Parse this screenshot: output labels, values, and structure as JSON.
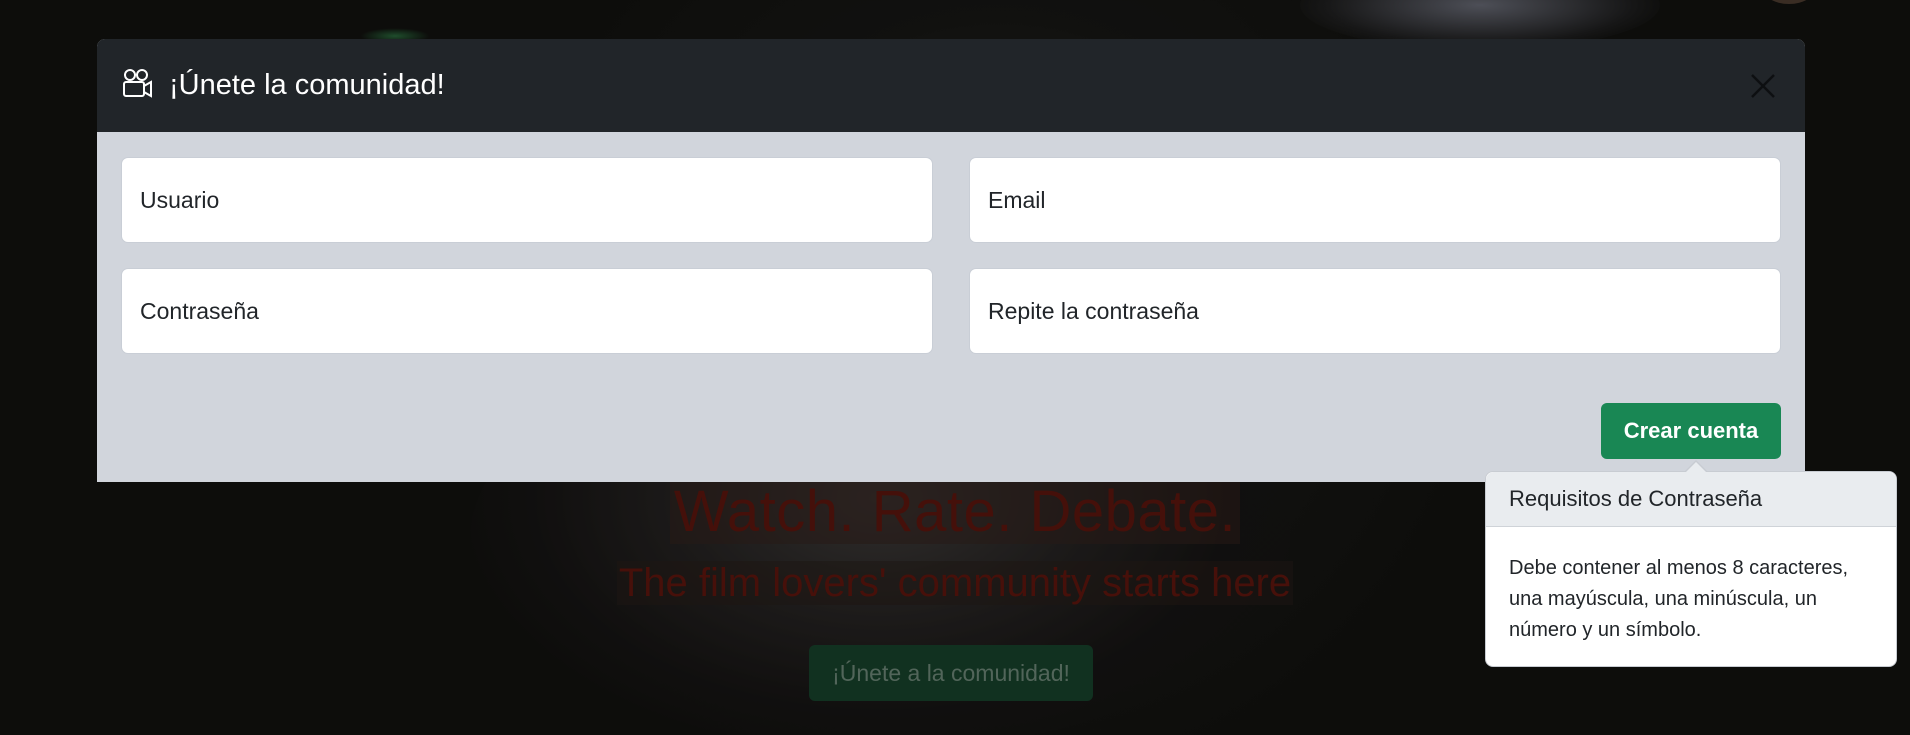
{
  "modal": {
    "title": "¡Únete la comunidad!",
    "fields": {
      "username_placeholder": "Usuario",
      "email_placeholder": "Email",
      "password_placeholder": "Contraseña",
      "repeat_password_placeholder": "Repite la contraseña"
    },
    "submit_label": "Crear cuenta"
  },
  "popover": {
    "title": "Requisitos de Contraseña",
    "body": "Debe contener al menos 8 caracteres, una mayúscula, una minúscula, un número y un símbolo."
  },
  "hero": {
    "title": "Watch. Rate. Debate.",
    "subtitle": "The film lovers' community starts here",
    "cta_label": "¡Únete a la comunidad!"
  },
  "colors": {
    "header_bg": "#212529",
    "modal_bg": "#d1d5dc",
    "primary_green": "#198754",
    "hero_red": "#6b1a10"
  },
  "icons": {
    "header_icon": "camera-reels-icon",
    "close_icon": "close-icon"
  }
}
